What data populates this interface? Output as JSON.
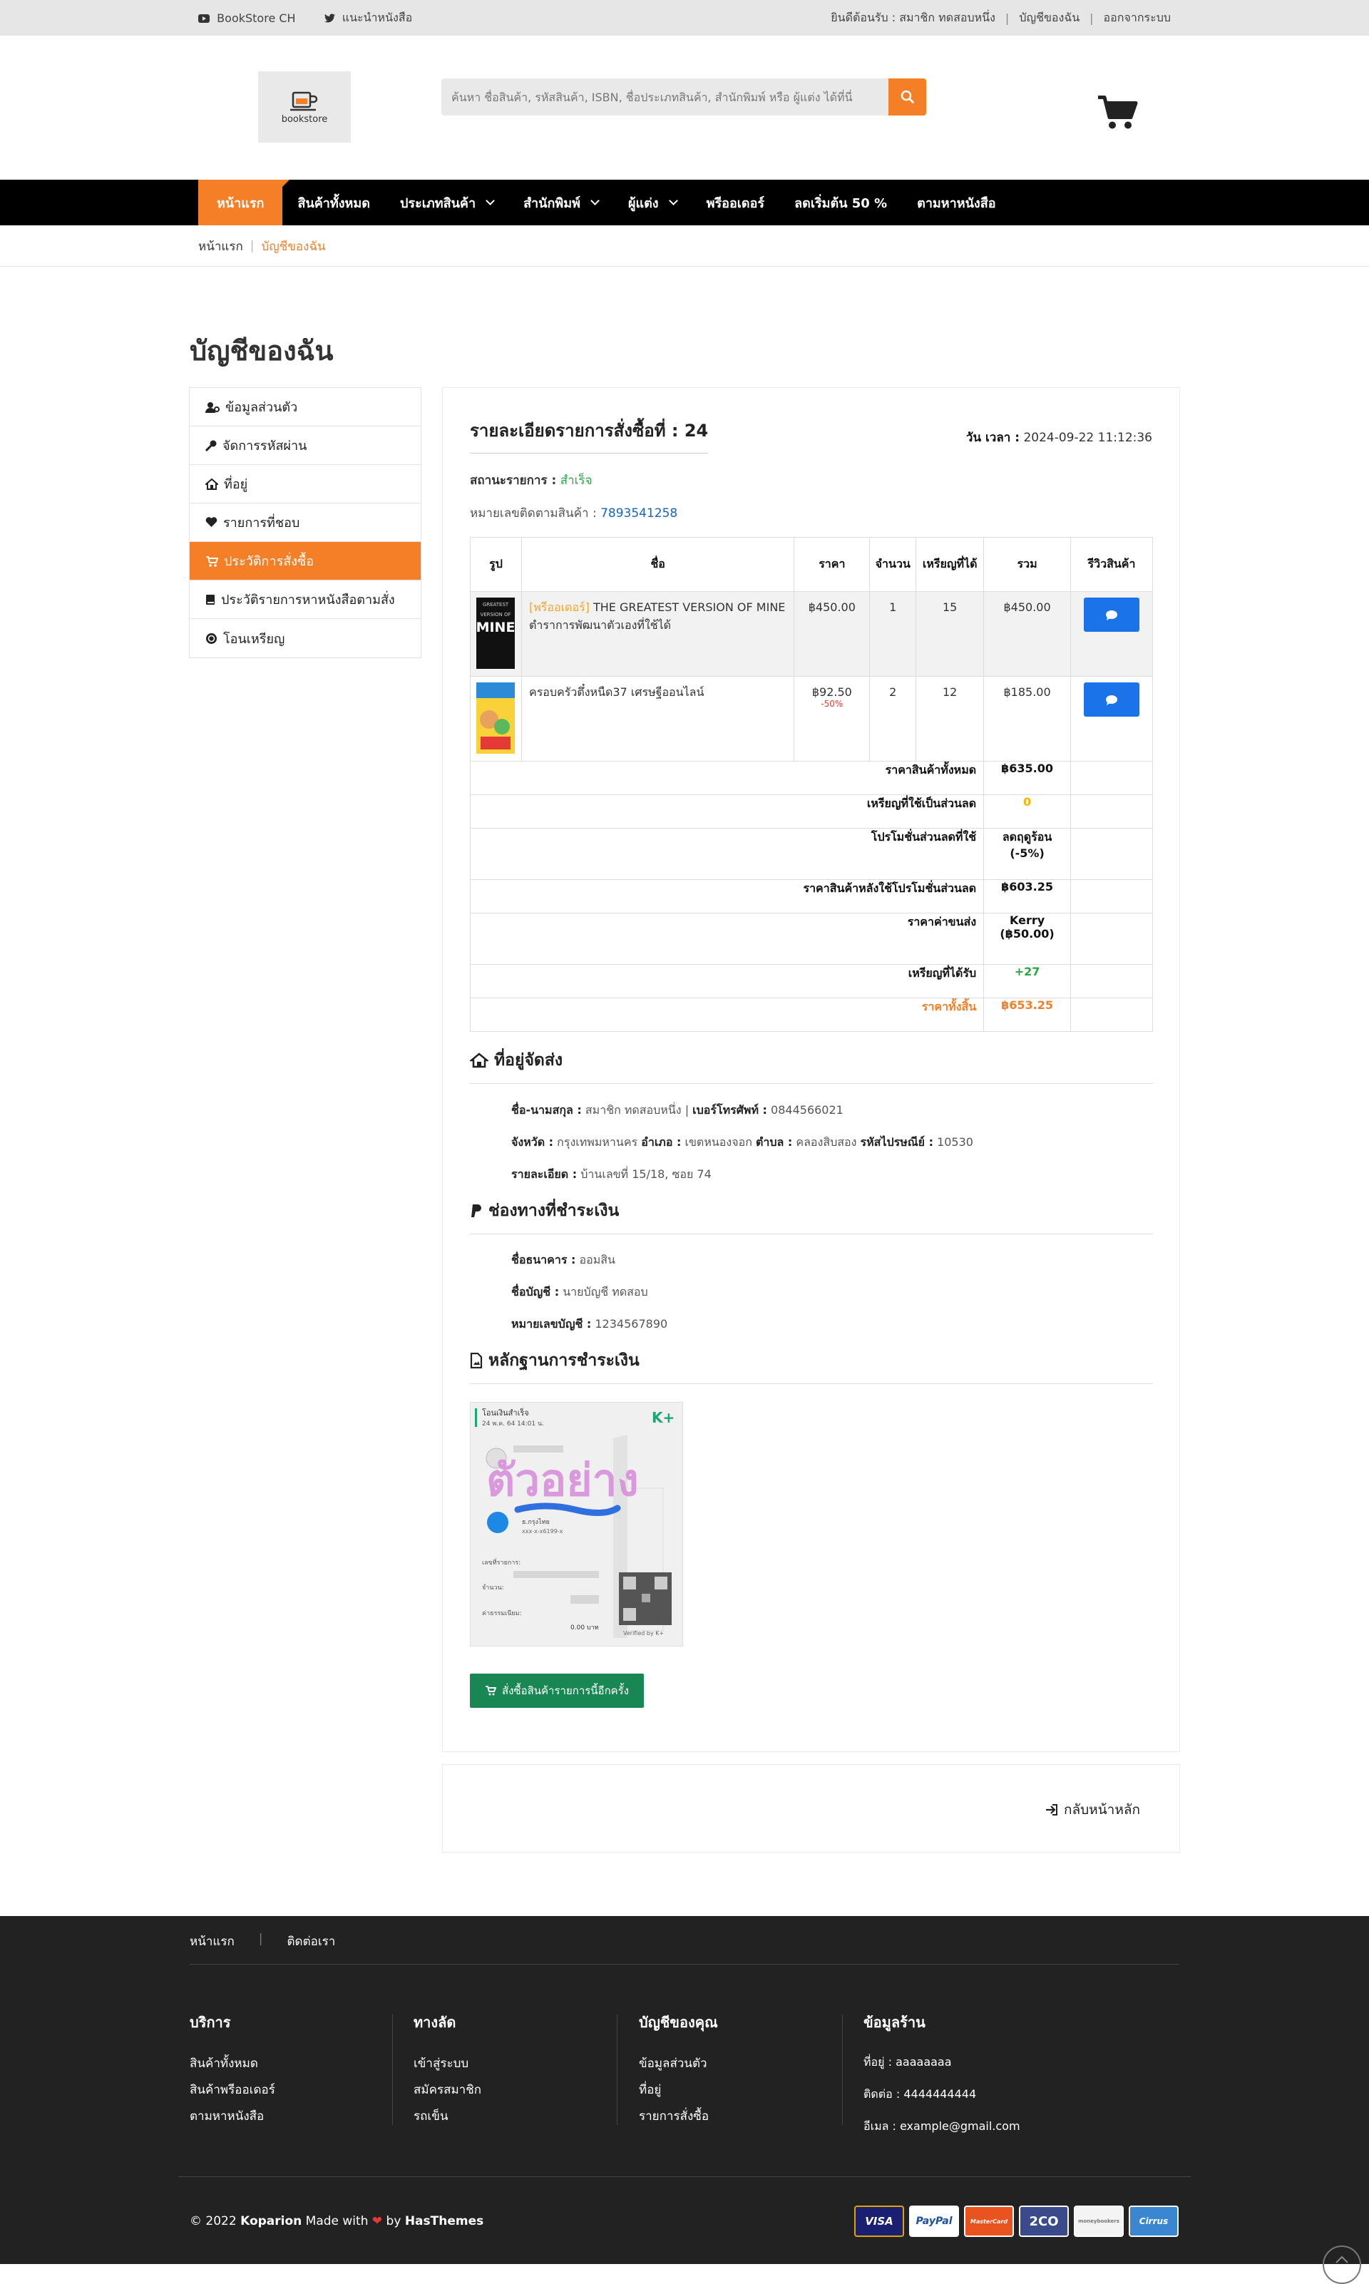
{
  "topbar": {
    "left": [
      "BookStore CH",
      "แนะนำหนังสือ"
    ],
    "welcome": "ยินดีต้อนรับ : สมาชิก ทดสอบหนึ่ง",
    "my_account": "บัญชีของฉัน",
    "logout": "ออกจากระบบ"
  },
  "header": {
    "logo_text": "bookstore",
    "search_placeholder": "ค้นหา ชื่อสินค้า, รหัสสินค้า, ISBN, ชื่อประเภทสินค้า, สำนักพิมพ์ หรือ ผู้แต่ง ได้ที่นี่"
  },
  "nav": [
    "หน้าแรก",
    "สินค้าทั้งหมด",
    "ประเภทสินค้า",
    "สำนักพิมพ์",
    "ผู้แต่ง",
    "พรีออเดอร์",
    "ลดเริ่มต้น 50 %",
    "ตามหาหนังสือ"
  ],
  "breadcrumb": {
    "home": "หน้าแรก",
    "current": "บัญชีของฉัน"
  },
  "page_title": "บัญชีของฉัน",
  "sidebar": [
    "ข้อมูลส่วนตัว",
    "จัดการรหัสผ่าน",
    "ที่อยู่",
    "รายการที่ชอบ",
    "ประวัติการสั่งซื้อ",
    "ประวัติรายการหาหนังสือตามสั่ง",
    "โอนเหรียญ"
  ],
  "order": {
    "title": "รายละเอียดรายการสั่งซื้อที่ : 24",
    "date_label": "วัน เวลา :",
    "date": "2024-09-22 11:12:36",
    "status_label": "สถานะรายการ :",
    "status": "สำเร็จ",
    "tracking_label": "หมายเลขติดตามสินค้า :",
    "tracking": "7893541258"
  },
  "table": {
    "headers": [
      "รูป",
      "ชื่อ",
      "ราคา",
      "จำนวน",
      "เหรียญที่ได้",
      "รวม",
      "รีวิวสินค้า"
    ],
    "rows": [
      {
        "prefix": "[พรีออเดอร์]",
        "name": "THE GREATEST VERSION OF MINE ตำราการพัฒนาตัวเองที่ใช้ได้",
        "price": "฿450.00",
        "discount": "",
        "qty": "1",
        "coins": "15",
        "total": "฿450.00"
      },
      {
        "prefix": "",
        "name": "ครอบครัวตึ๋งหนืด37 เศรษฐีออนไลน์",
        "price": "฿92.50",
        "discount": "-50%",
        "qty": "2",
        "coins": "12",
        "total": "฿185.00"
      }
    ],
    "summary": [
      {
        "label": "ราคาสินค้าทั้งหมด",
        "value": "฿635.00"
      },
      {
        "label": "เหรียญที่ใช้เป็นส่วนลด",
        "value": "0"
      },
      {
        "label": "โปรโมชั่นส่วนลดที่ใช้",
        "value": "ลดฤดูร้อน (-5%)"
      },
      {
        "label": "ราคาสินค้าหลังใช้โปรโมชั่นส่วนลด",
        "value": "฿603.25"
      },
      {
        "label": "ราคาค่าขนส่ง",
        "value": "Kerry (฿50.00)"
      },
      {
        "label": "เหรียญที่ได้รับ",
        "value": "+27"
      },
      {
        "label": "ราคาทั้งสิ้น",
        "value": "฿653.25"
      }
    ]
  },
  "shipping": {
    "heading": "ที่อยู่จัดส่ง",
    "name_label": "ชื่อ-นามสกุล :",
    "name": "สมาชิก ทดสอบหนึ่ง",
    "phone_label": "เบอร์โทรศัพท์ :",
    "phone": "0844566021",
    "province_label": "จังหวัด :",
    "province": "กรุงเทพมหานคร",
    "district_label": "อำเภอ :",
    "district": "เขตหนองจอก",
    "subdistrict_label": "ตำบล :",
    "subdistrict": "คลองสิบสอง",
    "zip_label": "รหัสไปรษณีย์ :",
    "zip": "10530",
    "detail_label": "รายละเอียด :",
    "detail": "บ้านเลขที่ 15/18, ซอย 74"
  },
  "payment": {
    "heading": "ช่องทางที่ชำระเงิน",
    "bank_label": "ชื่อธนาคาร :",
    "bank": "ออมสิน",
    "account_label": "ชื่อบัญชี :",
    "account": "นายบัญชี ทดสอบ",
    "number_label": "หมายเลขบัญชี :",
    "number": "1234567890"
  },
  "proof": {
    "heading": "หลักฐานการชำระเงิน",
    "slip_title": "โอนเงินสำเร็จ",
    "slip_date": "24 พ.ค. 64 14:01 น.",
    "slip_brand": "K+",
    "slip_watermark": "ตัวอย่าง",
    "slip_bank": "ธ.กรุงไทย",
    "slip_acct": "xxx-x-x6199-x",
    "slip_ref": "เลขที่รายการ:",
    "slip_amount": "จำนวน:",
    "slip_fee": "ค่าธรรมเนียม:",
    "slip_fee_val": "0.00 บาท",
    "slip_verified": "Verified by K+"
  },
  "reorder_button": "สั่งซื้อสินค้ารายการนี้อีกครั้ง",
  "back_button": "กลับหน้าหลัก",
  "footer": {
    "top": [
      "หน้าแรก",
      "ติดต่อเรา"
    ],
    "cols": [
      {
        "title": "บริการ",
        "items": [
          "สินค้าทั้งหมด",
          "สินค้าพรีออเดอร์",
          "ตามหาหนังสือ"
        ]
      },
      {
        "title": "ทางลัด",
        "items": [
          "เข้าสู่ระบบ",
          "สมัครสมาชิก",
          "รถเข็น"
        ]
      },
      {
        "title": "บัญชีของคุณ",
        "items": [
          "ข้อมูลส่วนตัว",
          "ที่อยู่",
          "รายการสั่งซื้อ"
        ]
      },
      {
        "title": "ข้อมูลร้าน",
        "items": [
          "ที่อยู่ : aaaaaaaa",
          "ติดต่อ : 4444444444",
          "อีเมล : example@gmail.com"
        ]
      }
    ],
    "copy_pre": "© 2022 ",
    "copy_brand": "Koparion",
    "copy_mid": " Made with ",
    "copy_by": " by ",
    "copy_author": "HasThemes",
    "cards": [
      "VISA",
      "PayPal",
      "MasterCard",
      "2CO",
      "moneybookers",
      "Cirrus"
    ]
  },
  "colors": {
    "accent": "#f47f27",
    "success": "#28a745",
    "link": "#1565c0",
    "review_button": "#1a73e8",
    "reorder": "#198754",
    "footer_bg": "#222222"
  }
}
